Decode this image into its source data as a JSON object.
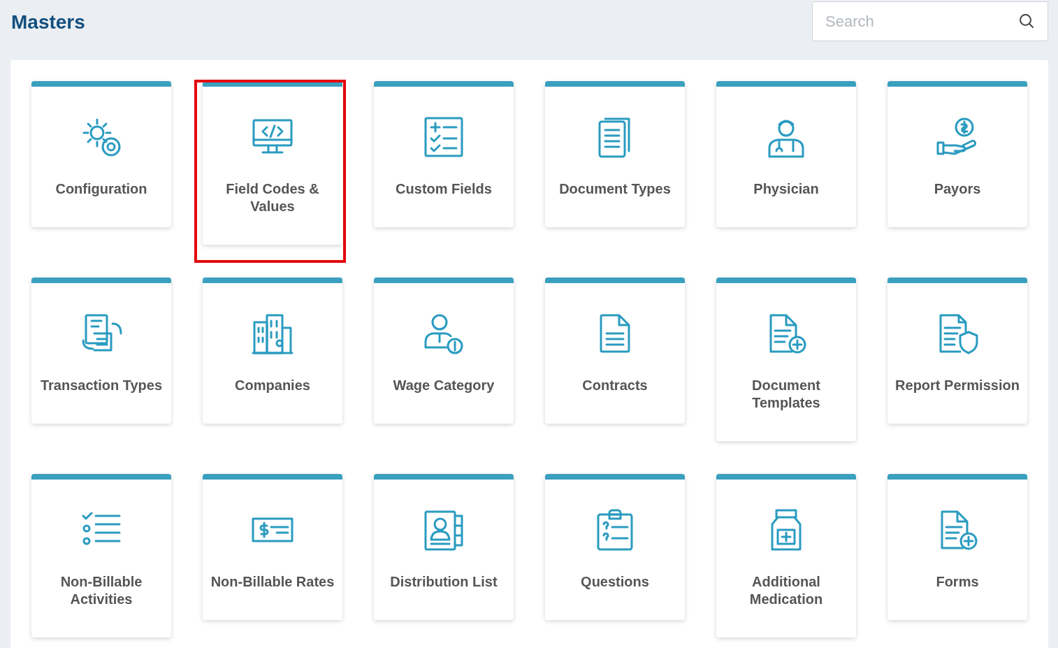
{
  "header": {
    "title": "Masters",
    "search": {
      "placeholder": "Search"
    }
  },
  "tiles": [
    {
      "label": "Configuration",
      "highlighted": false
    },
    {
      "label": "Field Codes & Values",
      "highlighted": true
    },
    {
      "label": "Custom Fields",
      "highlighted": false
    },
    {
      "label": "Document Types",
      "highlighted": false
    },
    {
      "label": "Physician",
      "highlighted": false
    },
    {
      "label": "Payors",
      "highlighted": false
    },
    {
      "label": "Transaction Types",
      "highlighted": false
    },
    {
      "label": "Companies",
      "highlighted": false
    },
    {
      "label": "Wage Category",
      "highlighted": false
    },
    {
      "label": "Contracts",
      "highlighted": false
    },
    {
      "label": "Document Templates",
      "highlighted": false
    },
    {
      "label": "Report Permission",
      "highlighted": false
    },
    {
      "label": "Non-Billable Activities",
      "highlighted": false
    },
    {
      "label": "Non-Billable Rates",
      "highlighted": false
    },
    {
      "label": "Distribution List",
      "highlighted": false
    },
    {
      "label": "Questions",
      "highlighted": false
    },
    {
      "label": "Additional Medication",
      "highlighted": false
    },
    {
      "label": "Forms",
      "highlighted": false
    }
  ]
}
